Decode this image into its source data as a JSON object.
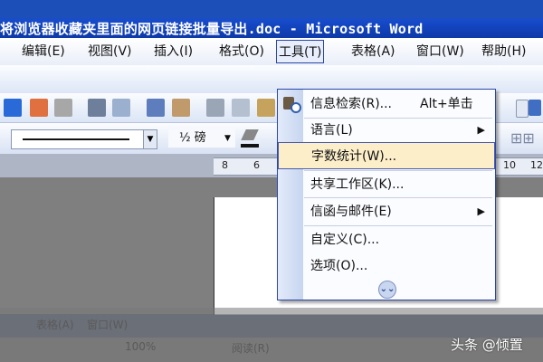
{
  "title": "将浏览器收藏夹里面的网页链接批量导出.doc - Microsoft Word",
  "menu": [
    "编辑(E)",
    "视图(V)",
    "插入(I)",
    "格式(O)",
    "工具(T)",
    "表格(A)",
    "窗口(W)",
    "帮助(H)"
  ],
  "menu_left_fragment": "。",
  "toolbar": {
    "style_value": "½ 磅",
    "ruler_numbers": [
      "8",
      "6",
      "10",
      "12"
    ]
  },
  "tools_menu": {
    "items": [
      {
        "label": "信息检索(R)...",
        "shortcut": "Alt+单击"
      },
      {
        "label": "语言(L)",
        "submenu": true
      },
      {
        "label": "字数统计(W)...",
        "highlighted": true
      },
      {
        "label": "共享工作区(K)..."
      },
      {
        "label": "信函与邮件(E)",
        "submenu": true
      },
      {
        "label": "自定义(C)..."
      },
      {
        "label": "选项(O)..."
      }
    ],
    "expand_icon": "double-chevron-down-icon"
  },
  "ghost_status": [
    "表格(A)",
    "窗口(W)",
    "100%",
    "阅读(R)"
  ],
  "watermark": "头条 @倾置",
  "colors": {
    "titlebar": "#1548c6",
    "highlight": "#fbeec9",
    "menu_border": "#2b46a8"
  }
}
